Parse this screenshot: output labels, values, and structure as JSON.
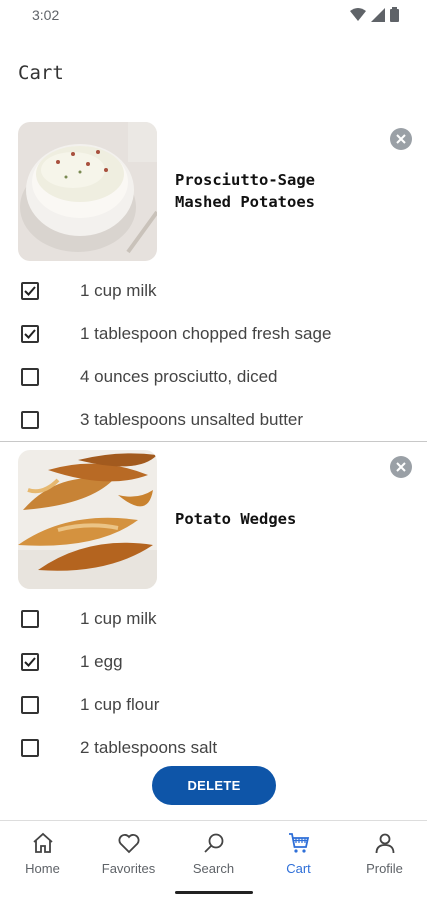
{
  "status": {
    "time": "3:02"
  },
  "page": {
    "title": "Cart"
  },
  "recipes": [
    {
      "name": "Prosciutto-Sage\nMashed Potatoes",
      "ingredients": [
        {
          "text": "1 cup milk",
          "checked": true
        },
        {
          "text": "1 tablespoon chopped fresh sage",
          "checked": true
        },
        {
          "text": "4 ounces prosciutto, diced",
          "checked": false
        },
        {
          "text": "3 tablespoons unsalted butter",
          "checked": false
        }
      ]
    },
    {
      "name": "Potato Wedges",
      "ingredients": [
        {
          "text": "1 cup milk",
          "checked": false
        },
        {
          "text": "1 egg",
          "checked": true
        },
        {
          "text": "1 cup flour",
          "checked": false
        },
        {
          "text": "2 tablespoons salt",
          "checked": false
        }
      ]
    }
  ],
  "actions": {
    "delete_label": "DELETE"
  },
  "nav": [
    {
      "label": "Home",
      "icon": "home-icon"
    },
    {
      "label": "Favorites",
      "icon": "heart-icon"
    },
    {
      "label": "Search",
      "icon": "search-icon"
    },
    {
      "label": "Cart",
      "icon": "cart-icon",
      "active": true
    },
    {
      "label": "Profile",
      "icon": "person-icon"
    }
  ],
  "colors": {
    "accent": "#0e55a8",
    "nav_active": "#2e6fd8"
  }
}
